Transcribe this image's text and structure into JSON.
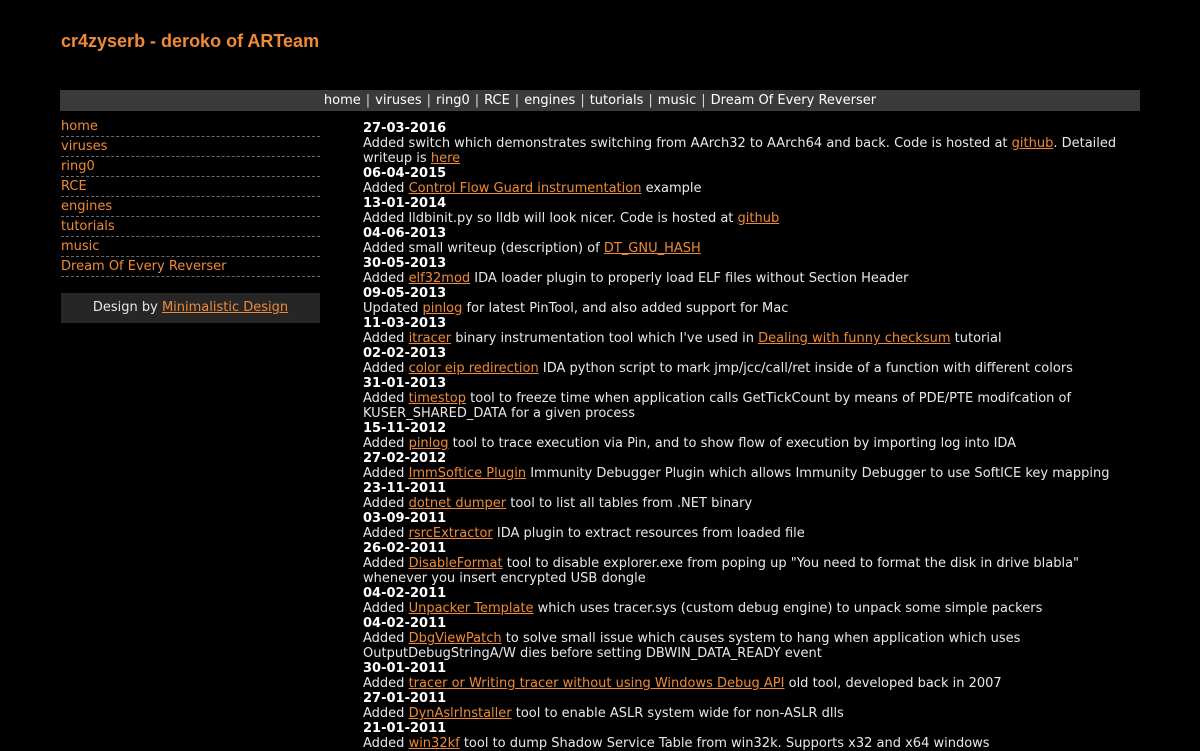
{
  "site": {
    "title": "cr4zyserb - deroko of ARTeam"
  },
  "topnav": [
    "home",
    "viruses",
    "ring0",
    "RCE",
    "engines",
    "tutorials",
    "music",
    "Dream Of Every Reverser"
  ],
  "sidebar": {
    "items": [
      "home",
      "viruses",
      "ring0",
      "RCE",
      "engines",
      "tutorials",
      "music",
      "Dream Of Every Reverser"
    ],
    "design_prefix": "Design by ",
    "design_link": "Minimalistic Design"
  },
  "news": [
    {
      "date": "27-03-2016",
      "parts": [
        {
          "t": "Added switch which demonstrates switching from AArch32 to AArch64 and back. Code is hosted at "
        },
        {
          "l": "github"
        },
        {
          "t": ". Detailed writeup is "
        },
        {
          "l": "here"
        }
      ]
    },
    {
      "date": "06-04-2015",
      "parts": [
        {
          "t": "Added "
        },
        {
          "l": "Control Flow Guard instrumentation"
        },
        {
          "t": " example"
        }
      ]
    },
    {
      "date": "13-01-2014",
      "parts": [
        {
          "t": "Added lldbinit.py so lldb will look nicer. Code is hosted at "
        },
        {
          "l": "github"
        }
      ]
    },
    {
      "date": "04-06-2013",
      "parts": [
        {
          "t": "Added small writeup (description) of "
        },
        {
          "l": "DT_GNU_HASH"
        }
      ]
    },
    {
      "date": "30-05-2013",
      "parts": [
        {
          "t": "Added "
        },
        {
          "l": "elf32mod"
        },
        {
          "t": " IDA loader plugin to properly load ELF files without Section Header"
        }
      ]
    },
    {
      "date": "09-05-2013",
      "parts": [
        {
          "t": "Updated "
        },
        {
          "l": "pinlog"
        },
        {
          "t": " for latest PinTool, and also added support for Mac"
        }
      ]
    },
    {
      "date": "11-03-2013",
      "parts": [
        {
          "t": "Added "
        },
        {
          "l": "itracer"
        },
        {
          "t": " binary instrumentation tool which I've used in "
        },
        {
          "l": "Dealing with funny checksum"
        },
        {
          "t": " tutorial"
        }
      ]
    },
    {
      "date": "02-02-2013",
      "parts": [
        {
          "t": "Added "
        },
        {
          "l": "color eip redirection"
        },
        {
          "t": " IDA python script to mark jmp/jcc/call/ret inside of a function with different colors"
        }
      ]
    },
    {
      "date": "31-01-2013",
      "parts": [
        {
          "t": "Added "
        },
        {
          "l": "timestop"
        },
        {
          "t": " tool to freeze time when application calls GetTickCount by means of PDE/PTE modifcation of KUSER_SHARED_DATA for a given process"
        }
      ]
    },
    {
      "date": "15-11-2012",
      "parts": [
        {
          "t": "Added "
        },
        {
          "l": "pinlog"
        },
        {
          "t": " tool to trace execution via Pin, and to show flow of execution by importing log into IDA"
        }
      ]
    },
    {
      "date": "27-02-2012",
      "parts": [
        {
          "t": "Added "
        },
        {
          "l": "ImmSoftice Plugin"
        },
        {
          "t": " Immunity Debugger Plugin which allows Immunity Debugger to use SoftICE key mapping"
        }
      ]
    },
    {
      "date": "23-11-2011",
      "parts": [
        {
          "t": "Added "
        },
        {
          "l": "dotnet dumper"
        },
        {
          "t": " tool to list all tables from .NET binary"
        }
      ]
    },
    {
      "date": "03-09-2011",
      "parts": [
        {
          "t": "Added "
        },
        {
          "l": "rsrcExtractor"
        },
        {
          "t": " IDA plugin to extract resources from loaded file"
        }
      ]
    },
    {
      "date": "26-02-2011",
      "parts": [
        {
          "t": "Added "
        },
        {
          "l": "DisableFormat"
        },
        {
          "t": " tool to disable explorer.exe from poping up \"You need to format the disk in drive blabla\" whenever you insert encrypted USB dongle"
        }
      ]
    },
    {
      "date": "04-02-2011",
      "parts": [
        {
          "t": "Added "
        },
        {
          "l": "Unpacker Template"
        },
        {
          "t": " which uses tracer.sys (custom debug engine) to unpack some simple packers"
        }
      ]
    },
    {
      "date": "04-02-2011",
      "parts": [
        {
          "t": "Added "
        },
        {
          "l": "DbgViewPatch"
        },
        {
          "t": " to solve small issue which causes system to hang when application which uses OutputDebugStringA/W dies before setting DBWIN_DATA_READY event"
        }
      ]
    },
    {
      "date": "30-01-2011",
      "parts": [
        {
          "t": "Added "
        },
        {
          "l": "tracer or Writing tracer without using Windows Debug API"
        },
        {
          "t": " old tool, developed back in 2007"
        }
      ]
    },
    {
      "date": "27-01-2011",
      "parts": [
        {
          "t": "Added "
        },
        {
          "l": "DynAslrInstaller"
        },
        {
          "t": " tool to enable ASLR system wide for non-ASLR dlls"
        }
      ]
    },
    {
      "date": "21-01-2011",
      "parts": [
        {
          "t": "Added "
        },
        {
          "l": "win32kf"
        },
        {
          "t": " tool to dump Shadow Service Table from win32k. Supports x32 and x64 windows"
        }
      ]
    }
  ]
}
